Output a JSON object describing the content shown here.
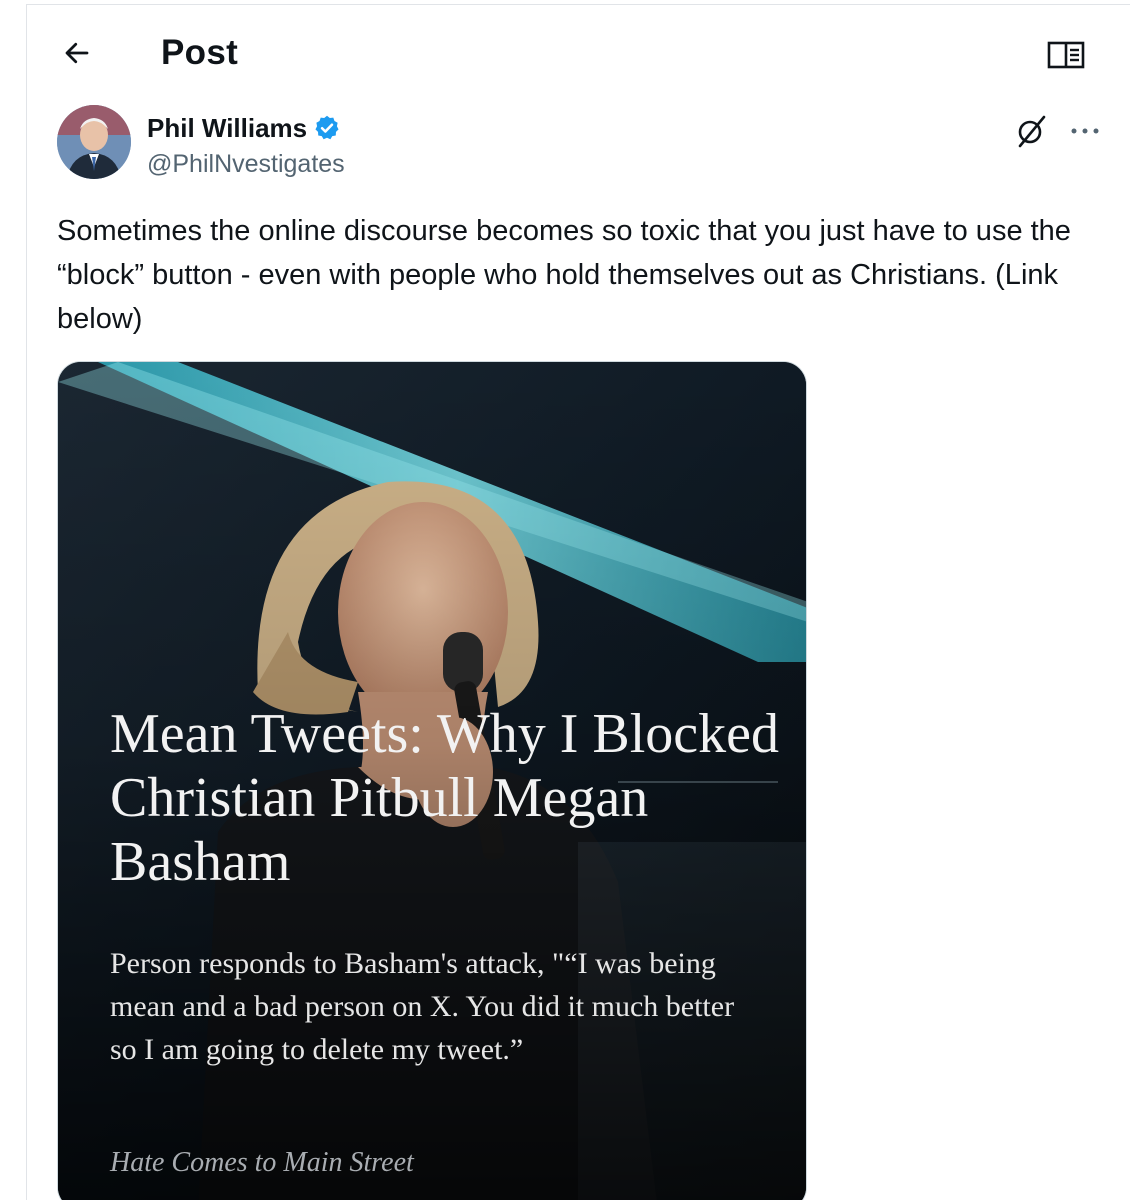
{
  "header": {
    "title": "Post",
    "back_icon": "arrow-left-icon",
    "reader_icon": "reader-mode-icon"
  },
  "post": {
    "author_name": "Phil Williams",
    "author_handle": "@PhilNvestigates",
    "verified": true,
    "text": "Sometimes the online discourse becomes so toxic that you just have to use the “block” button - even with people who hold themselves out as Christians. (Link below)"
  },
  "card": {
    "headline": "Mean Tweets: Why I Blocked Christian Pitbull Megan Basham",
    "subtitle": "Person responds to Basham's attack, \"“I was being mean and a bad person on X. You did it much better so I am going to delete my tweet.”",
    "source": "Hate Comes to Main Street"
  },
  "colors": {
    "text": "#0f1419",
    "secondary": "#536471",
    "verified_blue": "#1d9bf0",
    "card_bg": "#0c1218",
    "card_accent": "#37c6d6"
  }
}
